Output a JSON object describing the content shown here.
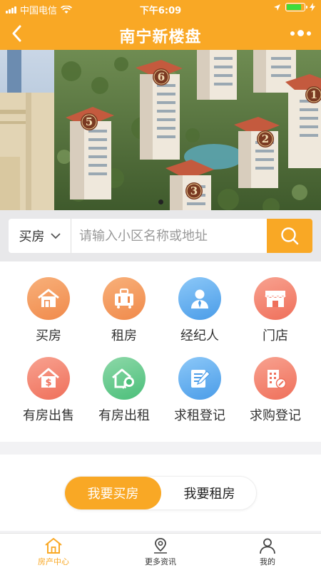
{
  "status": {
    "carrier": "中国电信",
    "time": "下午6:09",
    "battery_level": 0.85,
    "colors": {
      "bar": "#f9a825"
    }
  },
  "nav": {
    "title": "南宁新楼盘"
  },
  "banner": {
    "building_numbers": [
      "1",
      "2",
      "3",
      "5",
      "6"
    ],
    "page_count": 1,
    "active_page": 1
  },
  "search": {
    "type_label": "买房",
    "placeholder": "请输入小区名称或地址"
  },
  "grid": [
    {
      "label": "买房",
      "icon": "house-icon",
      "color_a": "#f8b07a",
      "color_b": "#f08a4b"
    },
    {
      "label": "租房",
      "icon": "suitcase-icon",
      "color_a": "#f8b07a",
      "color_b": "#f08a4b"
    },
    {
      "label": "经纪人",
      "icon": "agent-icon",
      "color_a": "#8cc8f8",
      "color_b": "#4a9ce8"
    },
    {
      "label": "门店",
      "icon": "store-icon",
      "color_a": "#f8a290",
      "color_b": "#ef6f5a"
    },
    {
      "label": "有房出售",
      "icon": "house-money-icon",
      "color_a": "#f8a290",
      "color_b": "#ef6f5a"
    },
    {
      "label": "有房出租",
      "icon": "house-key-icon",
      "color_a": "#8dd8a8",
      "color_b": "#4bbf7a"
    },
    {
      "label": "求租登记",
      "icon": "notepad-icon",
      "color_a": "#8cc8f8",
      "color_b": "#4a9ce8"
    },
    {
      "label": "求购登记",
      "icon": "building-icon",
      "color_a": "#f8a290",
      "color_b": "#ef6f5a"
    }
  ],
  "toggle": {
    "buy": "我要买房",
    "rent": "我要租房"
  },
  "tabs": [
    {
      "label": "房产中心",
      "icon": "home-icon",
      "active": true
    },
    {
      "label": "更多资讯",
      "icon": "map-pin-icon",
      "active": false
    },
    {
      "label": "我的",
      "icon": "user-icon",
      "active": false
    }
  ]
}
